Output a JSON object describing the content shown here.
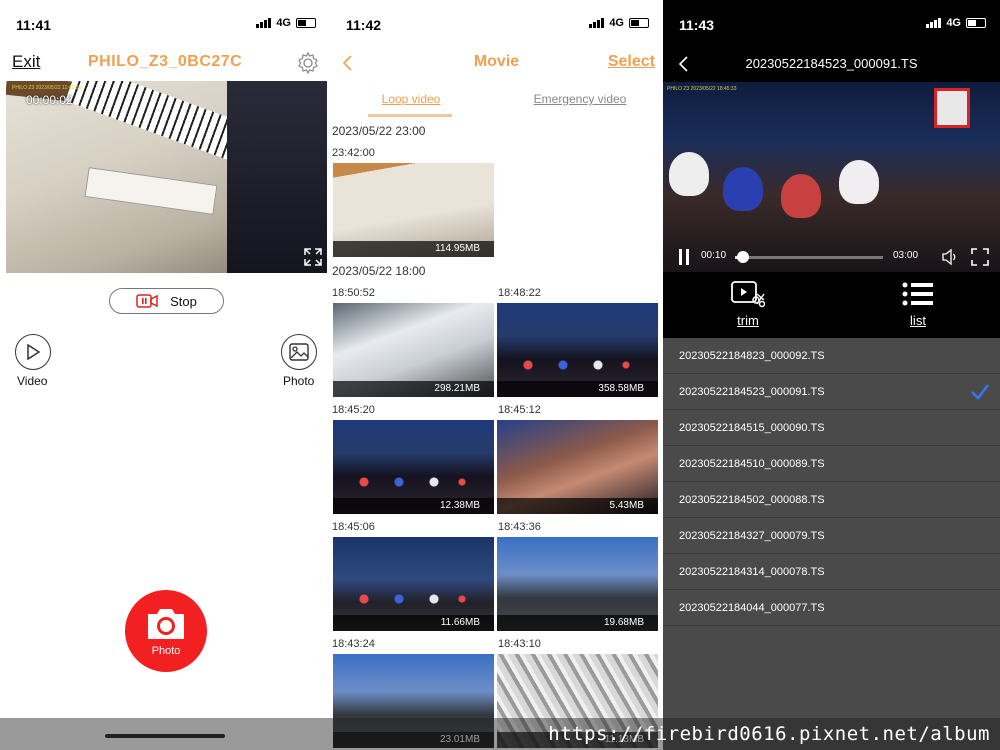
{
  "live_screen": {
    "status": {
      "time": "11:41",
      "network": "4G"
    },
    "exit_label": "Exit",
    "device_name": "PHILO_Z3_0BC27C",
    "preview": {
      "osd": "PHILO Z3 2023/05/22 11:41:05",
      "rec_time": "00:00:02"
    },
    "stop_label": "Stop",
    "video_label": "Video",
    "photo_label": "Photo",
    "shutter_label": "Photo"
  },
  "movie_screen": {
    "status": {
      "time": "11:42",
      "network": "4G"
    },
    "title": "Movie",
    "select_label": "Select",
    "tabs": [
      {
        "label": "Loop video",
        "active": true
      },
      {
        "label": "Emergency video",
        "active": false
      }
    ],
    "groups": [
      {
        "date": "2023/05/22 23:00"
      },
      {
        "date": "2023/05/22 18:00"
      }
    ],
    "clips": [
      {
        "time": "23:42:00",
        "size": "114.95MB"
      },
      {
        "time": "18:50:52",
        "size": "298.21MB"
      },
      {
        "time": "18:48:22",
        "size": "358.58MB"
      },
      {
        "time": "18:45:20",
        "size": "12.38MB"
      },
      {
        "time": "18:45:12",
        "size": "5.43MB"
      },
      {
        "time": "18:45:06",
        "size": "11.66MB"
      },
      {
        "time": "18:43:36",
        "size": "19.68MB"
      },
      {
        "time": "18:43:24",
        "size": "23.01MB"
      },
      {
        "time": "18:43:10",
        "size": "11.13MB"
      }
    ]
  },
  "player_screen": {
    "status": {
      "time": "11:43",
      "network": "4G"
    },
    "title": "20230522184523_000091.TS",
    "preview_osd": "PHILO Z3 2023/05/22 18:45:33",
    "current_time": "00:10",
    "total_time": "03:00",
    "progress": 0.056,
    "trim_label": "trim",
    "list_label": "list",
    "files": [
      {
        "name": "20230522184823_000092.TS",
        "selected": false
      },
      {
        "name": "20230522184523_000091.TS",
        "selected": true
      },
      {
        "name": "20230522184515_000090.TS",
        "selected": false
      },
      {
        "name": "20230522184510_000089.TS",
        "selected": false
      },
      {
        "name": "20230522184502_000088.TS",
        "selected": false
      },
      {
        "name": "20230522184327_000079.TS",
        "selected": false
      },
      {
        "name": "20230522184314_000078.TS",
        "selected": false
      },
      {
        "name": "20230522184044_000077.TS",
        "selected": false
      }
    ],
    "accent_color": "#3478f6"
  },
  "watermark": "https://firebird0616.pixnet.net/album"
}
